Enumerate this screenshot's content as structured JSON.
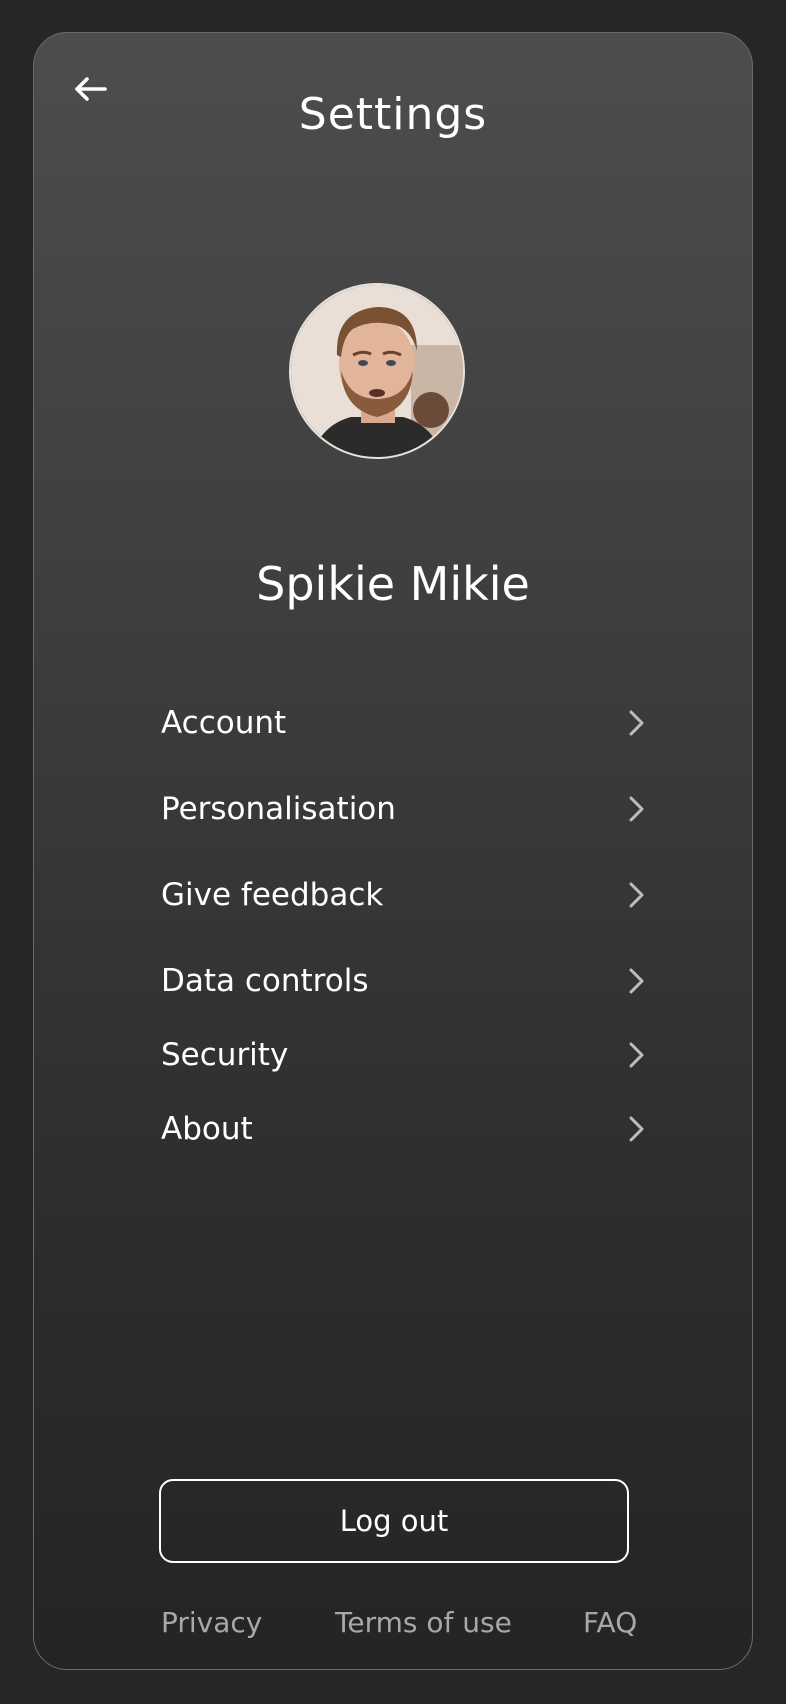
{
  "header": {
    "title": "Settings",
    "back_icon": "arrow-left-icon"
  },
  "profile": {
    "name": "Spikie Mikie",
    "avatar": "user-avatar-photo"
  },
  "menu": {
    "items": [
      {
        "label": "Account",
        "icon": "chevron-right-icon"
      },
      {
        "label": "Personalisation",
        "icon": "chevron-right-icon"
      },
      {
        "label": "Give feedback",
        "icon": "chevron-right-icon"
      },
      {
        "label": "Data controls",
        "icon": "chevron-right-icon"
      },
      {
        "label": "Security",
        "icon": "chevron-right-icon"
      },
      {
        "label": "About",
        "icon": "chevron-right-icon"
      }
    ]
  },
  "actions": {
    "logout_label": "Log out"
  },
  "footer": {
    "privacy": "Privacy",
    "terms": "Terms of use",
    "faq": "FAQ"
  },
  "colors": {
    "background": "#262626",
    "text": "#ffffff",
    "muted": "#a8a8a8",
    "chevron": "#bdbdbd"
  }
}
